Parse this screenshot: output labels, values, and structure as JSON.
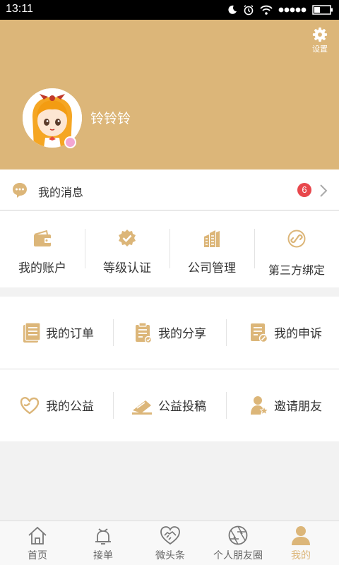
{
  "status_bar": {
    "time": "13:11"
  },
  "colors": {
    "accent": "#dcb679",
    "badge": "#e8474c",
    "icon": "#dcb679"
  },
  "header": {
    "settings_label": "设置",
    "username": "铃铃铃"
  },
  "messages": {
    "label": "我的消息",
    "badge_count": "6"
  },
  "quick_actions": [
    {
      "label": "我的账户",
      "icon": "wallet-icon"
    },
    {
      "label": "等级认证",
      "icon": "verified-badge-icon"
    },
    {
      "label": "公司管理",
      "icon": "buildings-icon"
    },
    {
      "label": "第三方绑定",
      "icon": "link-icon"
    }
  ],
  "menu_row1": [
    {
      "label": "我的订单",
      "icon": "orders-icon"
    },
    {
      "label": "我的分享",
      "icon": "share-icon"
    },
    {
      "label": "我的申诉",
      "icon": "appeal-icon"
    }
  ],
  "menu_row2": [
    {
      "label": "我的公益",
      "icon": "charity-heart-icon"
    },
    {
      "label": "公益投稿",
      "icon": "submit-envelope-icon"
    },
    {
      "label": "邀请朋友",
      "icon": "invite-user-icon"
    }
  ],
  "tabs": [
    {
      "label": "首页",
      "icon": "home-icon",
      "active": false
    },
    {
      "label": "接单",
      "icon": "bell-icon",
      "active": false
    },
    {
      "label": "微头条",
      "icon": "handshake-heart-icon",
      "active": false
    },
    {
      "label": "个人朋友圈",
      "icon": "aperture-icon",
      "active": false
    },
    {
      "label": "我的",
      "icon": "user-icon",
      "active": true
    }
  ]
}
